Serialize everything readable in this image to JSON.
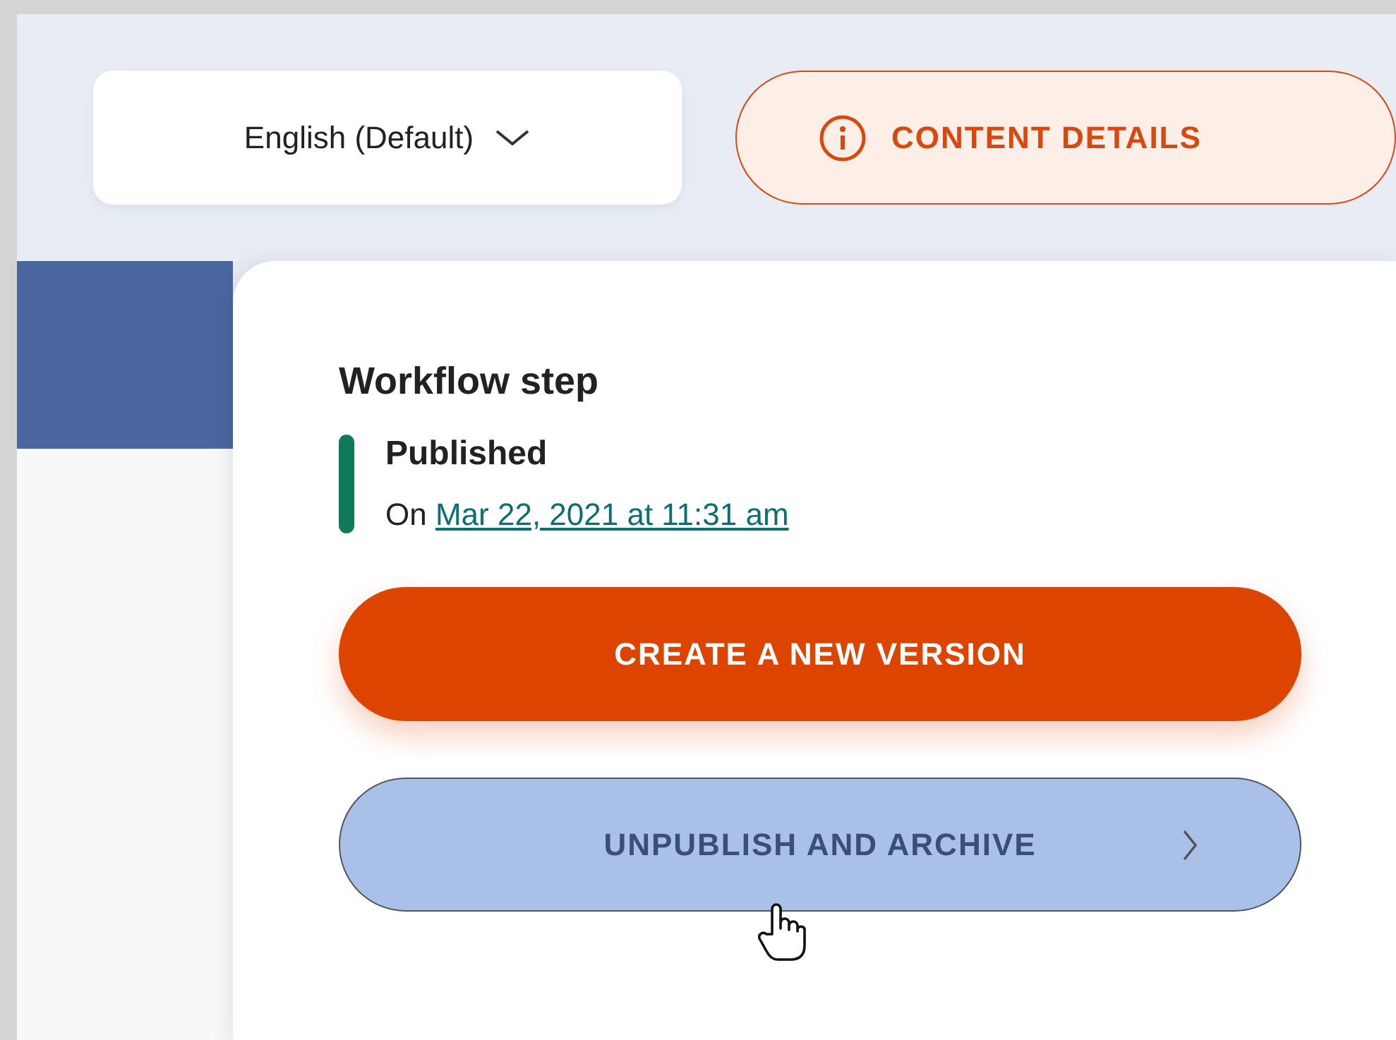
{
  "language_select": {
    "value": "English (Default)"
  },
  "content_details_button": {
    "label": "CONTENT DETAILS"
  },
  "workflow": {
    "heading": "Workflow step",
    "status": "Published",
    "date_prefix": "On",
    "date_link": "Mar 22, 2021 at 11:31 am"
  },
  "buttons": [
    {
      "label": "CREATE A NEW VERSION",
      "kind": "primary"
    },
    {
      "label": "UNPUBLISH AND ARCHIVE",
      "kind": "secondary"
    }
  ]
}
